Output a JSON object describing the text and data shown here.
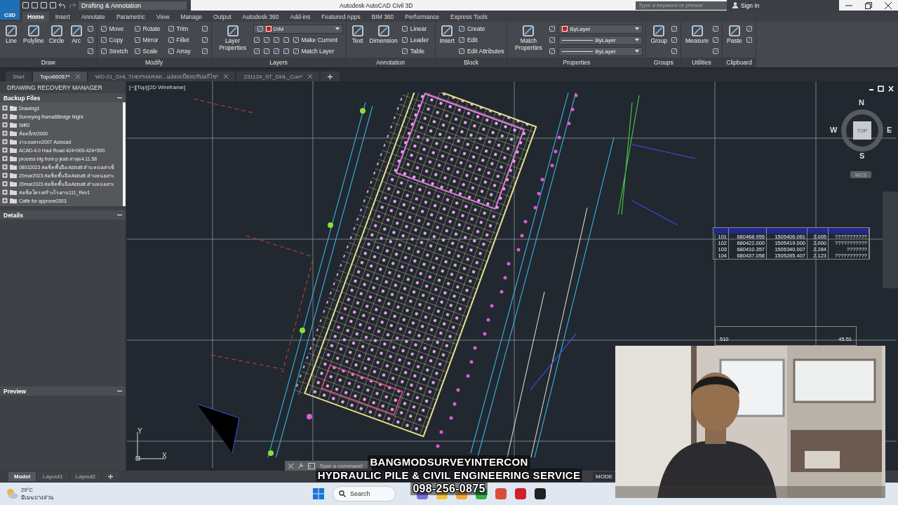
{
  "title_bar": {
    "app_badge": "C3D",
    "workspace": "Drafting & Annotation",
    "title": "Autodesk AutoCAD Civil 3D",
    "search_placeholder": "Type a keyword or phrase",
    "sign_in": "Sign In"
  },
  "ribbon_tabs": [
    {
      "label": "Home",
      "selected": true
    },
    {
      "label": "Insert",
      "selected": false
    },
    {
      "label": "Annotate",
      "selected": false
    },
    {
      "label": "Parametric",
      "selected": false
    },
    {
      "label": "View",
      "selected": false
    },
    {
      "label": "Manage",
      "selected": false
    },
    {
      "label": "Output",
      "selected": false
    },
    {
      "label": "Autodesk 360",
      "selected": false
    },
    {
      "label": "Add-ins",
      "selected": false
    },
    {
      "label": "Featured Apps",
      "selected": false
    },
    {
      "label": "BIM 360",
      "selected": false
    },
    {
      "label": "Performance",
      "selected": false
    },
    {
      "label": "Express Tools",
      "selected": false
    }
  ],
  "ribbon_panels": [
    {
      "title": "Draw",
      "large": [
        "Line",
        "Polyline",
        "Circle",
        "Arc"
      ],
      "rows": [
        [
          {
            "kind": "icon"
          }
        ],
        [
          {
            "kind": "icon"
          }
        ],
        [
          {
            "kind": "icon"
          }
        ]
      ]
    },
    {
      "title": "Modify",
      "rows": [
        [
          {
            "kind": "small",
            "label": "Move"
          },
          {
            "kind": "small",
            "label": "Rotate"
          },
          {
            "kind": "small",
            "label": "Trim"
          },
          {
            "kind": "icon"
          }
        ],
        [
          {
            "kind": "small",
            "label": "Copy"
          },
          {
            "kind": "small",
            "label": "Mirror"
          },
          {
            "kind": "small",
            "label": "Fillet"
          },
          {
            "kind": "icon"
          }
        ],
        [
          {
            "kind": "small",
            "label": "Stretch"
          },
          {
            "kind": "small",
            "label": "Scale"
          },
          {
            "kind": "small",
            "label": "Array"
          },
          {
            "kind": "icon"
          }
        ]
      ]
    },
    {
      "title": "Layers",
      "large": [
        "Layer Properties"
      ],
      "rows": [
        [
          {
            "kind": "layer-dropdown",
            "label": "DIM"
          }
        ],
        [
          {
            "kind": "icon"
          },
          {
            "kind": "icon"
          },
          {
            "kind": "icon"
          },
          {
            "kind": "icon"
          },
          {
            "kind": "small",
            "label": "Make Current"
          }
        ],
        [
          {
            "kind": "icon"
          },
          {
            "kind": "icon"
          },
          {
            "kind": "icon"
          },
          {
            "kind": "icon"
          },
          {
            "kind": "small",
            "label": "Match Layer"
          }
        ]
      ]
    },
    {
      "title": "Annotation",
      "large": [
        "Text",
        "Dimension"
      ],
      "rows": [
        [
          {
            "kind": "small",
            "label": "Linear"
          }
        ],
        [
          {
            "kind": "small",
            "label": "Leader"
          }
        ],
        [
          {
            "kind": "small",
            "label": "Table"
          }
        ]
      ]
    },
    {
      "title": "Block",
      "large": [
        "Insert"
      ],
      "rows": [
        [
          {
            "kind": "small",
            "label": "Create"
          }
        ],
        [
          {
            "kind": "small",
            "label": "Edit"
          }
        ],
        [
          {
            "kind": "small",
            "label": "Edit Attributes"
          }
        ]
      ]
    },
    {
      "title": "Properties",
      "large": [
        "Match Properties"
      ],
      "rows": [
        [
          {
            "kind": "icon"
          },
          {
            "kind": "color-dropdown",
            "label": "ByLayer"
          }
        ],
        [
          {
            "kind": "icon"
          },
          {
            "kind": "line-dropdown",
            "label": "ByLayer"
          }
        ],
        [
          {
            "kind": "icon"
          },
          {
            "kind": "line-dropdown",
            "label": "ByLayer"
          }
        ]
      ]
    },
    {
      "title": "Groups",
      "large": [
        "Group"
      ],
      "rows": [
        [
          {
            "kind": "icon"
          }
        ],
        [
          {
            "kind": "icon"
          }
        ],
        [
          {
            "kind": "icon"
          }
        ]
      ]
    },
    {
      "title": "Utilities",
      "large": [
        "Measure"
      ],
      "rows": [
        [
          {
            "kind": "icon"
          }
        ],
        [
          {
            "kind": "icon"
          }
        ],
        [
          {
            "kind": "icon"
          }
        ]
      ]
    },
    {
      "title": "Clipboard",
      "large": [
        "Paste"
      ],
      "rows": [
        [
          {
            "kind": "icon"
          }
        ],
        [
          {
            "kind": "icon"
          }
        ]
      ]
    }
  ],
  "file_tabs": [
    {
      "label": "Start",
      "selected": false,
      "closable": false
    },
    {
      "label": "Topo66057*",
      "selected": true,
      "closable": true
    },
    {
      "label": "WD-01_DHL THEPHARAK...แสดงเบียดปรับแก้ไข*",
      "selected": false,
      "closable": true
    },
    {
      "label": "231124_ST_DHL_Con*",
      "selected": false,
      "closable": true
    }
  ],
  "recovery_manager": {
    "title": "DRAWING RECOVERY MANAGER",
    "sections": [
      {
        "title": "Backup Files",
        "expanded": true,
        "items": [
          {
            "label": "Drawing3",
            "expanded": false
          },
          {
            "label": "Surveying Rama8Bridge Night",
            "expanded": false
          },
          {
            "label": "Stiff2",
            "expanded": false
          },
          {
            "label": "สั่งเหล็กV2000",
            "expanded": false
          },
          {
            "label": "งานจอดรถ2007 Autocad",
            "expanded": false
          },
          {
            "label": "ACAD-4.0 Haul Road 424+000-424+500",
            "expanded": false
          },
          {
            "label": "process blg from p jeab ล่าสุด4.11.58",
            "expanded": false
          },
          {
            "label": "08032023 ส่งเช็คพื้นฉีดAsbuilt ตำแหน่งเสาเข็",
            "expanded": false
          },
          {
            "label": "20mar2023 ส่งเช็คพื้นฉีดAsbuilt ตำแหน่งเสาเ",
            "expanded": false
          },
          {
            "label": "20mar2023 ส่งเช็คพื้นฉีดAsbuilt ตำแหน่งเสาเ",
            "expanded": false
          },
          {
            "label": "ส่งเช็คโครงสร้างโรงงาน111_Rev1",
            "expanded": false
          },
          {
            "label": "Caffe for approve0303",
            "expanded": false
          }
        ]
      },
      {
        "title": "Details",
        "expanded": true
      },
      {
        "title": "Preview",
        "expanded": true
      }
    ]
  },
  "viewport": {
    "label": "[−][Top][2D Wireframe]",
    "compass": {
      "north": "N",
      "south": "S",
      "east": "E",
      "west": "W",
      "top": "TOP",
      "ucs": "WCS"
    },
    "axis_x": "X",
    "axis_y": "Y",
    "point_table": {
      "rows": [
        [
          "101",
          "680468.955",
          "1505406.061",
          "2.005",
          "???????????"
        ],
        [
          "102",
          "680422.000",
          "1505419.000",
          "2.000",
          "???????????"
        ],
        [
          "103",
          "680410.357",
          "1505340.007",
          "2.284",
          "???????"
        ],
        [
          "104",
          "680437.058",
          "1505285.407",
          "2.123",
          "???????????"
        ]
      ]
    },
    "lower_table": {
      "cells": [
        "510",
        "45.51"
      ]
    },
    "command_placeholder": "Type a command"
  },
  "layout_tabs": [
    {
      "label": "Model",
      "selected": true
    },
    {
      "label": "Layout1",
      "selected": false
    },
    {
      "label": "Layout2",
      "selected": false
    }
  ],
  "status_bar": {
    "mode": "MODE"
  },
  "video_overlay": {
    "lines": [
      "BANGMODSURVEYINTERCON",
      "HYDRAULIC PILE & CIVIL ENGINEERING SERVICE",
      "098-256-0875"
    ],
    "camera": {
      "kind": "picture"
    }
  },
  "taskbar": {
    "temperature": "29°C",
    "condition": "มีเมฆบางส่วน",
    "search": "Search"
  }
}
